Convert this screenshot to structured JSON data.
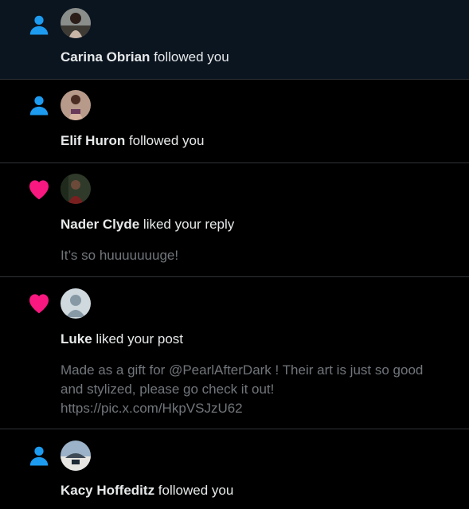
{
  "colors": {
    "follow_icon": "#1d9bf0",
    "like_icon": "#f91880",
    "divider": "#2f3336",
    "unread_bg": "#0b1520"
  },
  "notifications": [
    {
      "type": "follow",
      "icon": "person-icon",
      "name": "Carina Obrian",
      "action": " followed you"
    },
    {
      "type": "follow",
      "icon": "person-icon",
      "name": "Elif Huron",
      "action": " followed you"
    },
    {
      "type": "like",
      "icon": "heart-icon",
      "name": "Nader Clyde",
      "action": " liked your reply",
      "snippet": "It’s so huuuuuuuge!"
    },
    {
      "type": "like",
      "icon": "heart-icon",
      "name": "Luke",
      "action": " liked your post",
      "snippet_line1": "Made as a gift for @PearlAfterDark ! Their art is just so good",
      "snippet_line2": "and stylized, please go check it out!",
      "snippet_link": "https://pic.x.com/HkpVSJzU62"
    },
    {
      "type": "follow",
      "icon": "person-icon",
      "name": "Kacy Hoffeditz",
      "action": " followed you"
    }
  ]
}
